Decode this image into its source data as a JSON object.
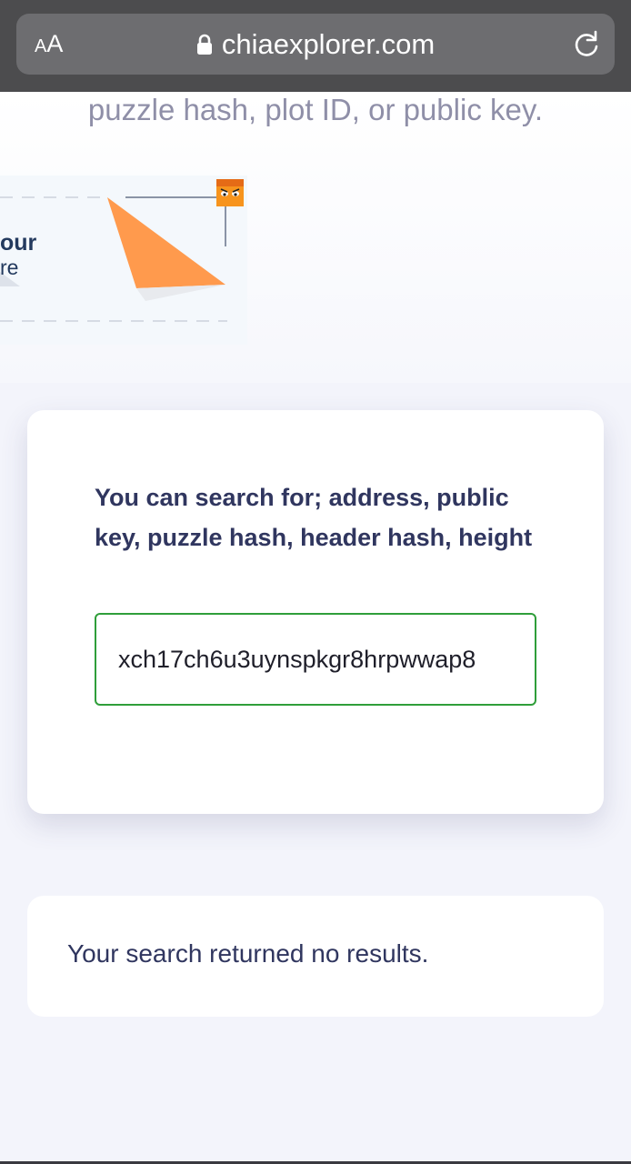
{
  "browser": {
    "text_size_label_small": "A",
    "text_size_label_large": "A",
    "url": "chiaexplorer.com"
  },
  "page": {
    "subtitle": "puzzle hash, plot ID, or public key.",
    "banner": {
      "line1": "our",
      "line2": "re"
    },
    "search": {
      "label": "You can search for; address, public key, puzzle hash, header hash, height",
      "value": "xch17ch6u3uynspkgr8hrpwwap8"
    },
    "results": {
      "message": "Your search returned no results."
    }
  },
  "colors": {
    "browser_bar": "#4c4c4e",
    "accent_green": "#2f9e3a",
    "heading": "#30365f",
    "banner_orange": "#ff9a4d"
  },
  "icons": [
    "lock-icon",
    "reload-icon",
    "paper-plane-illustration",
    "angry-face-icon"
  ]
}
